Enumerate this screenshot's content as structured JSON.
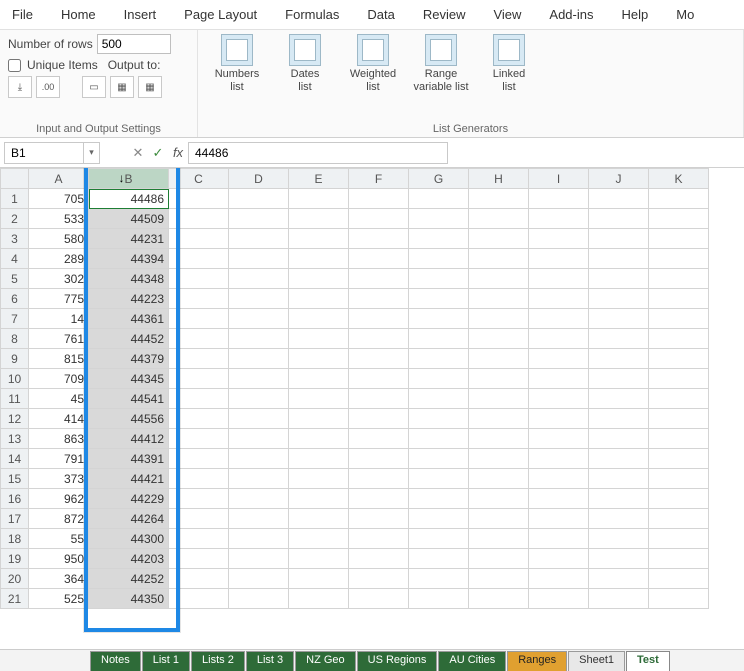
{
  "ribbon_tabs": [
    "File",
    "Home",
    "Insert",
    "Page Layout",
    "Formulas",
    "Data",
    "Review",
    "View",
    "Add-ins",
    "Help",
    "Mo"
  ],
  "io_group": {
    "num_rows_label": "Number of rows",
    "num_rows_value": "500",
    "unique_label": "Unique Items",
    "output_label": "Output to:",
    "group_label": "Input and Output Settings"
  },
  "gen_group": {
    "label": "List Generators",
    "items": [
      {
        "l1": "Numbers",
        "l2": "list"
      },
      {
        "l1": "Dates",
        "l2": "list"
      },
      {
        "l1": "Weighted",
        "l2": "list"
      },
      {
        "l1": "Range",
        "l2": "variable list"
      },
      {
        "l1": "Linked",
        "l2": "list"
      }
    ]
  },
  "namebox": "B1",
  "formula_value": "44486",
  "columns": [
    "A",
    "B",
    "C",
    "D",
    "E",
    "F",
    "G",
    "H",
    "I",
    "J",
    "K"
  ],
  "rows": [
    {
      "n": 1,
      "a": "705",
      "b": "44486"
    },
    {
      "n": 2,
      "a": "533",
      "b": "44509"
    },
    {
      "n": 3,
      "a": "580",
      "b": "44231"
    },
    {
      "n": 4,
      "a": "289",
      "b": "44394"
    },
    {
      "n": 5,
      "a": "302",
      "b": "44348"
    },
    {
      "n": 6,
      "a": "775",
      "b": "44223"
    },
    {
      "n": 7,
      "a": "14",
      "b": "44361"
    },
    {
      "n": 8,
      "a": "761",
      "b": "44452"
    },
    {
      "n": 9,
      "a": "815",
      "b": "44379"
    },
    {
      "n": 10,
      "a": "709",
      "b": "44345"
    },
    {
      "n": 11,
      "a": "45",
      "b": "44541"
    },
    {
      "n": 12,
      "a": "414",
      "b": "44556"
    },
    {
      "n": 13,
      "a": "863",
      "b": "44412"
    },
    {
      "n": 14,
      "a": "791",
      "b": "44391"
    },
    {
      "n": 15,
      "a": "373",
      "b": "44421"
    },
    {
      "n": 16,
      "a": "962",
      "b": "44229"
    },
    {
      "n": 17,
      "a": "872",
      "b": "44264"
    },
    {
      "n": 18,
      "a": "55",
      "b": "44300"
    },
    {
      "n": 19,
      "a": "950",
      "b": "44203"
    },
    {
      "n": 20,
      "a": "364",
      "b": "44252"
    },
    {
      "n": 21,
      "a": "525",
      "b": "44350"
    }
  ],
  "sheet_tabs": [
    {
      "label": "Notes",
      "cls": "stab"
    },
    {
      "label": "List 1",
      "cls": "stab"
    },
    {
      "label": "Lists 2",
      "cls": "stab"
    },
    {
      "label": "List 3",
      "cls": "stab"
    },
    {
      "label": "NZ Geo",
      "cls": "stab"
    },
    {
      "label": "US Regions",
      "cls": "stab"
    },
    {
      "label": "AU Cities",
      "cls": "stab"
    },
    {
      "label": "Ranges",
      "cls": "stab orange"
    },
    {
      "label": "Sheet1",
      "cls": "stab gray"
    },
    {
      "label": "Test",
      "cls": "stab white"
    }
  ]
}
